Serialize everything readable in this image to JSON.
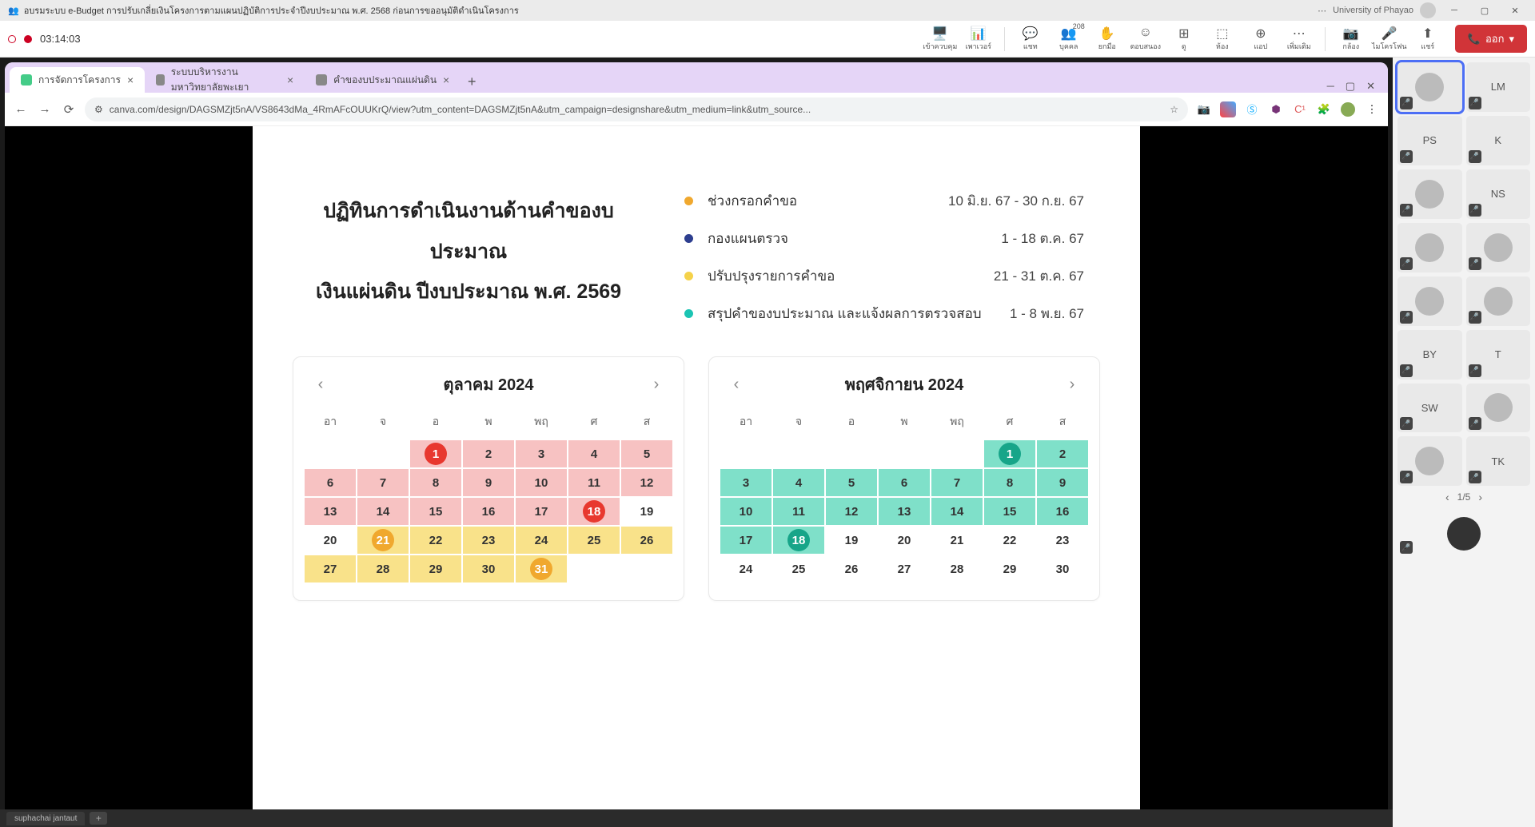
{
  "teams": {
    "meeting_title": "อบรมระบบ e-Budget การปรับเกลี่ยเงินโครงการตามแผนปฏิบัติการประจำปีงบประมาณ พ.ศ. 2568 ก่อนการขออนุมัติดำเนินโครงการ",
    "org": "University of Phayao",
    "rec_time": "03:14:03",
    "tools": {
      "share": "เข้าควบคุม",
      "powerpoint": "เพาเวอร์",
      "chat": "แชท",
      "people": "บุคคล",
      "people_count": "208",
      "raise": "ยกมือ",
      "react": "ตอบสนอง",
      "view": "ดู",
      "rooms": "ห้อง",
      "apps": "แอป",
      "more": "เพิ่มเติม",
      "camera": "กล้อง",
      "mic": "ไมโครโฟน",
      "audio": "แชร์"
    },
    "leave": "ออก"
  },
  "browser": {
    "tabs": [
      {
        "label": "การจัดการโครงการ",
        "active": true
      },
      {
        "label": "ระบบบริหารงานมหาวิทยาลัยพะเยา",
        "active": false
      },
      {
        "label": "คำของบประมาณแผ่นดิน",
        "active": false
      }
    ],
    "url": "canva.com/design/DAGSMZjt5nA/VS8643dMa_4RmAFcOUUKrQ/view?utm_content=DAGSMZjt5nA&utm_campaign=designshare&utm_medium=link&utm_source..."
  },
  "page": {
    "title_line1": "ปฏิทินการดำเนินงานด้านคำของบประมาณ",
    "title_line2": "เงินแผ่นดิน ปีงบประมาณ พ.ศ. 2569",
    "legend": [
      {
        "color": "#f0a82e",
        "label": "ช่วงกรอกคำขอ",
        "date": "10 มิ.ย. 67 - 30 ก.ย. 67"
      },
      {
        "color": "#2d3e8f",
        "label": "กองแผนตรวจ",
        "date": "1 - 18 ต.ค. 67"
      },
      {
        "color": "#f5d24a",
        "label": "ปรับปรุงรายการคำขอ",
        "date": "21 - 31 ต.ค. 67"
      },
      {
        "color": "#1bc4b3",
        "label": "สรุปคำของบประมาณ และแจ้งผลการตรวจสอบ",
        "date": "1 - 8 พ.ย. 67"
      }
    ],
    "dow": [
      "อา",
      "จ",
      "อ",
      "พ",
      "พฤ",
      "ศ",
      "ส"
    ],
    "cal1": {
      "title": "ตุลาคม 2024",
      "days": [
        {
          "n": "",
          "c": ""
        },
        {
          "n": "",
          "c": ""
        },
        {
          "n": "1",
          "c": "pink",
          "circle": "red"
        },
        {
          "n": "2",
          "c": "pink"
        },
        {
          "n": "3",
          "c": "pink"
        },
        {
          "n": "4",
          "c": "pink"
        },
        {
          "n": "5",
          "c": "pink"
        },
        {
          "n": "6",
          "c": "pink"
        },
        {
          "n": "7",
          "c": "pink"
        },
        {
          "n": "8",
          "c": "pink"
        },
        {
          "n": "9",
          "c": "pink"
        },
        {
          "n": "10",
          "c": "pink"
        },
        {
          "n": "11",
          "c": "pink"
        },
        {
          "n": "12",
          "c": "pink"
        },
        {
          "n": "13",
          "c": "pink"
        },
        {
          "n": "14",
          "c": "pink"
        },
        {
          "n": "15",
          "c": "pink"
        },
        {
          "n": "16",
          "c": "pink"
        },
        {
          "n": "17",
          "c": "pink"
        },
        {
          "n": "18",
          "c": "pink",
          "circle": "red"
        },
        {
          "n": "19",
          "c": ""
        },
        {
          "n": "20",
          "c": ""
        },
        {
          "n": "21",
          "c": "yellow",
          "circle": "orange"
        },
        {
          "n": "22",
          "c": "yellow"
        },
        {
          "n": "23",
          "c": "yellow"
        },
        {
          "n": "24",
          "c": "yellow"
        },
        {
          "n": "25",
          "c": "yellow"
        },
        {
          "n": "26",
          "c": "yellow"
        },
        {
          "n": "27",
          "c": "yellow"
        },
        {
          "n": "28",
          "c": "yellow"
        },
        {
          "n": "29",
          "c": "yellow"
        },
        {
          "n": "30",
          "c": "yellow"
        },
        {
          "n": "31",
          "c": "yellow",
          "circle": "orange"
        },
        {
          "n": "",
          "c": ""
        },
        {
          "n": "",
          "c": ""
        }
      ]
    },
    "cal2": {
      "title": "พฤศจิกายน 2024",
      "days": [
        {
          "n": "",
          "c": ""
        },
        {
          "n": "",
          "c": ""
        },
        {
          "n": "",
          "c": ""
        },
        {
          "n": "",
          "c": ""
        },
        {
          "n": "",
          "c": ""
        },
        {
          "n": "1",
          "c": "teal",
          "circle": "green"
        },
        {
          "n": "2",
          "c": "teal"
        },
        {
          "n": "3",
          "c": "teal"
        },
        {
          "n": "4",
          "c": "teal"
        },
        {
          "n": "5",
          "c": "teal"
        },
        {
          "n": "6",
          "c": "teal"
        },
        {
          "n": "7",
          "c": "teal"
        },
        {
          "n": "8",
          "c": "teal"
        },
        {
          "n": "9",
          "c": "teal"
        },
        {
          "n": "10",
          "c": "teal"
        },
        {
          "n": "11",
          "c": "teal"
        },
        {
          "n": "12",
          "c": "teal"
        },
        {
          "n": "13",
          "c": "teal"
        },
        {
          "n": "14",
          "c": "teal"
        },
        {
          "n": "15",
          "c": "teal"
        },
        {
          "n": "16",
          "c": "teal"
        },
        {
          "n": "17",
          "c": "teal"
        },
        {
          "n": "18",
          "c": "teal",
          "circle": "green"
        },
        {
          "n": "19",
          "c": ""
        },
        {
          "n": "20",
          "c": ""
        },
        {
          "n": "21",
          "c": ""
        },
        {
          "n": "22",
          "c": ""
        },
        {
          "n": "23",
          "c": ""
        },
        {
          "n": "24",
          "c": ""
        },
        {
          "n": "25",
          "c": ""
        },
        {
          "n": "26",
          "c": ""
        },
        {
          "n": "27",
          "c": ""
        },
        {
          "n": "28",
          "c": ""
        },
        {
          "n": "29",
          "c": ""
        },
        {
          "n": "30",
          "c": ""
        }
      ]
    }
  },
  "participants": {
    "tiles": [
      {
        "type": "img",
        "active": true
      },
      {
        "label": "LM"
      },
      {
        "label": "PS"
      },
      {
        "label": "K"
      },
      {
        "type": "img"
      },
      {
        "label": "NS"
      },
      {
        "type": "img"
      },
      {
        "type": "img"
      },
      {
        "type": "img"
      },
      {
        "type": "img"
      },
      {
        "label": "BY"
      },
      {
        "label": "T"
      },
      {
        "label": "SW"
      },
      {
        "type": "img"
      },
      {
        "type": "img"
      },
      {
        "label": "TK"
      }
    ],
    "pager": "1/5"
  },
  "taskbar": {
    "user": "suphachai jantaut"
  }
}
